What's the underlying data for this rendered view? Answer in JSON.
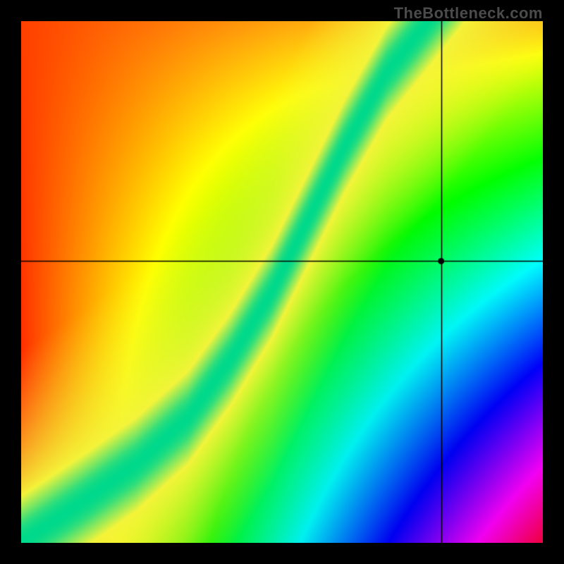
{
  "watermark": "TheBottleneck.com",
  "chart_data": {
    "type": "heatmap",
    "title": "",
    "xlabel": "",
    "ylabel": "",
    "xlim": [
      0,
      100
    ],
    "ylim": [
      0,
      100
    ],
    "grid": false,
    "legend": false,
    "ridge": {
      "description": "Optimal pairing curve (green band center), y as function of x in 0..100 space",
      "points": [
        {
          "x": 0,
          "y": 0
        },
        {
          "x": 12,
          "y": 8
        },
        {
          "x": 22,
          "y": 15
        },
        {
          "x": 32,
          "y": 24
        },
        {
          "x": 40,
          "y": 35
        },
        {
          "x": 48,
          "y": 48
        },
        {
          "x": 55,
          "y": 62
        },
        {
          "x": 62,
          "y": 76
        },
        {
          "x": 70,
          "y": 90
        },
        {
          "x": 78,
          "y": 100
        }
      ],
      "green_half_width": 4.0,
      "yellow_half_width": 9.0
    },
    "corner_colors": {
      "bottom_left_hue_deg": 0,
      "bottom_right_hue_deg": 355,
      "top_left_hue_deg": 5,
      "top_right_hue_deg": 50
    },
    "crosshair": {
      "x": 80.5,
      "y": 54.0,
      "marker_radius_frac": 0.006
    },
    "color_scale": {
      "optimal": "#00D98B",
      "near": "#F4F43A",
      "far_gpu_bound": "#FF9A1F",
      "far_cpu_bound": "#FF173F"
    }
  }
}
